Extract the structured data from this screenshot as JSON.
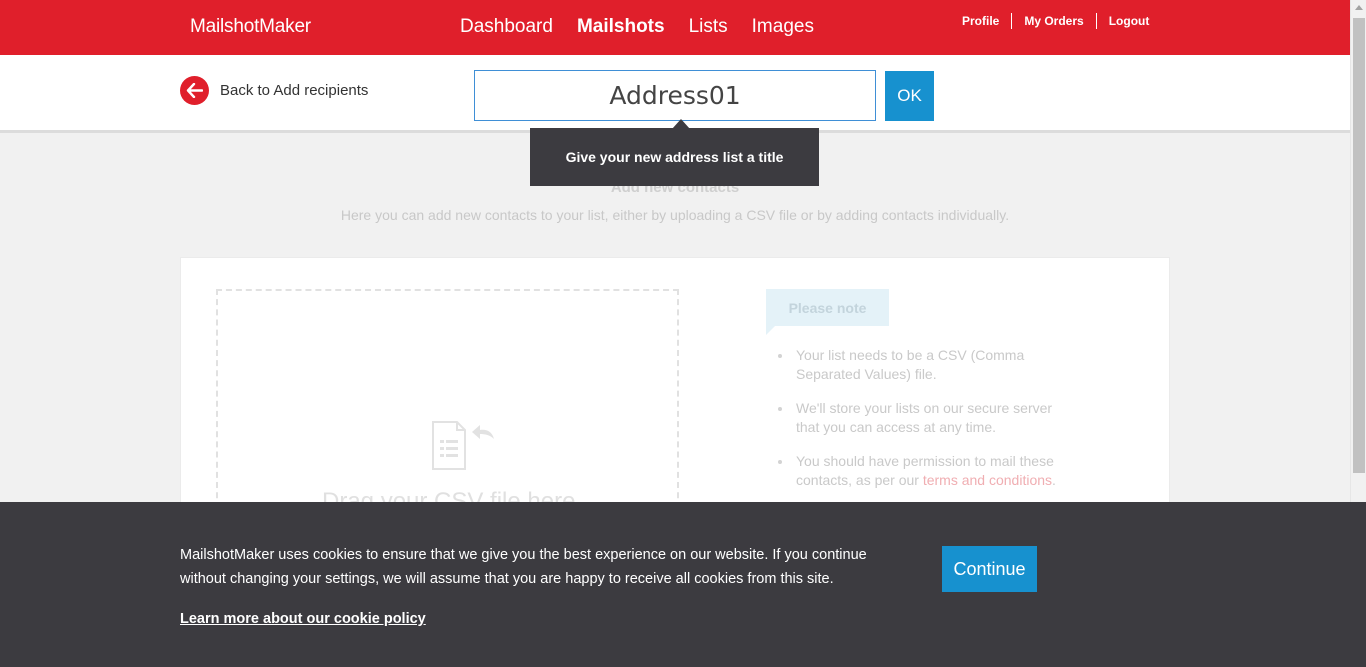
{
  "header": {
    "brand": "MailshotMaker",
    "nav": [
      {
        "label": "Dashboard"
      },
      {
        "label": "Mailshots"
      },
      {
        "label": "Lists"
      },
      {
        "label": "Images"
      }
    ],
    "user_links": {
      "profile": "Profile",
      "orders": "My Orders",
      "logout": "Logout"
    },
    "bg_color": "#e01f2b"
  },
  "subheader": {
    "back_label": "Back to Add recipients",
    "title_input_value": "Address01",
    "ok_label": "OK"
  },
  "tooltip": {
    "text": "Give your new address list a title"
  },
  "main": {
    "section_title": "Add new contacts",
    "section_desc": "Here you can add new contacts to your list, either by uploading a CSV file or by adding contacts individually.",
    "dropzone_text": "Drag your CSV file here",
    "note_label": "Please note",
    "notes": [
      {
        "text": "Your list needs to be a CSV (Comma Separated Values) file."
      },
      {
        "text": "We'll store your lists on our secure server that you can access at any time."
      },
      {
        "text": "You should have permission to mail these contacts, as per our ",
        "link": "terms and conditions",
        "suffix": "."
      }
    ]
  },
  "cookie_bar": {
    "text": "MailshotMaker uses cookies to ensure that we give you the best experience on our website. If you continue without changing your settings, we will assume that you are happy to receive all cookies from this site.",
    "link": "Learn more about our cookie policy",
    "button": "Continue"
  },
  "colors": {
    "accent_red": "#e01f2b",
    "button_blue": "#1791cf",
    "dark_overlay": "#3c3b40"
  }
}
